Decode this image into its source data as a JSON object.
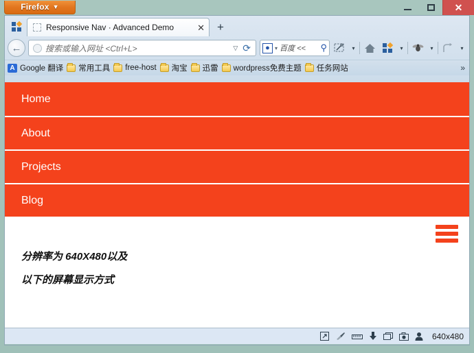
{
  "window": {
    "firefox_button": "Firefox",
    "firefox_caret": "▼",
    "minimize_label": "",
    "maximize_label": "",
    "close_label": "✕"
  },
  "tabstrip": {
    "applist_icon": "app-grid-icon",
    "tab_title": "Responsive Nav · Advanced Demo",
    "tab_close": "✕",
    "new_tab": "+"
  },
  "toolbar": {
    "back_arrow": "←",
    "url_placeholder": "搜索或输入网址 <Ctrl+L>",
    "url_value": "",
    "url_caret": "▽",
    "reload": "⟳",
    "search_engine": "百度",
    "search_placeholder": "<<",
    "search_caret": "▾",
    "magnifier": "🔍",
    "capture_caret": "▾",
    "apps_caret": "▾",
    "bug_caret": "▾",
    "undo_caret": "▾"
  },
  "bookmarks": {
    "items": [
      {
        "label": "Google 翻译",
        "icon": "translate-icon"
      },
      {
        "label": "常用工具",
        "icon": "folder-icon"
      },
      {
        "label": "free-host",
        "icon": "folder-icon"
      },
      {
        "label": "淘宝",
        "icon": "folder-icon"
      },
      {
        "label": "迅雷",
        "icon": "folder-icon"
      },
      {
        "label": "wordpress免费主题",
        "icon": "folder-icon"
      },
      {
        "label": "任务网站",
        "icon": "folder-icon"
      }
    ],
    "overflow": "»"
  },
  "page": {
    "accent_color": "#f4421c",
    "nav_items": [
      "Home",
      "About",
      "Projects",
      "Blog"
    ],
    "menu_toggle_icon": "hamburger-icon",
    "content_lines": [
      "分辨率为 640X480以及",
      "以下的屏幕显示方式"
    ]
  },
  "statusbar": {
    "icons": [
      "popout-icon",
      "brush-icon",
      "ruler-icon",
      "download-arrow-icon",
      "windows-stack-icon",
      "camera-icon",
      "person-icon"
    ],
    "resolution": "640x480"
  }
}
